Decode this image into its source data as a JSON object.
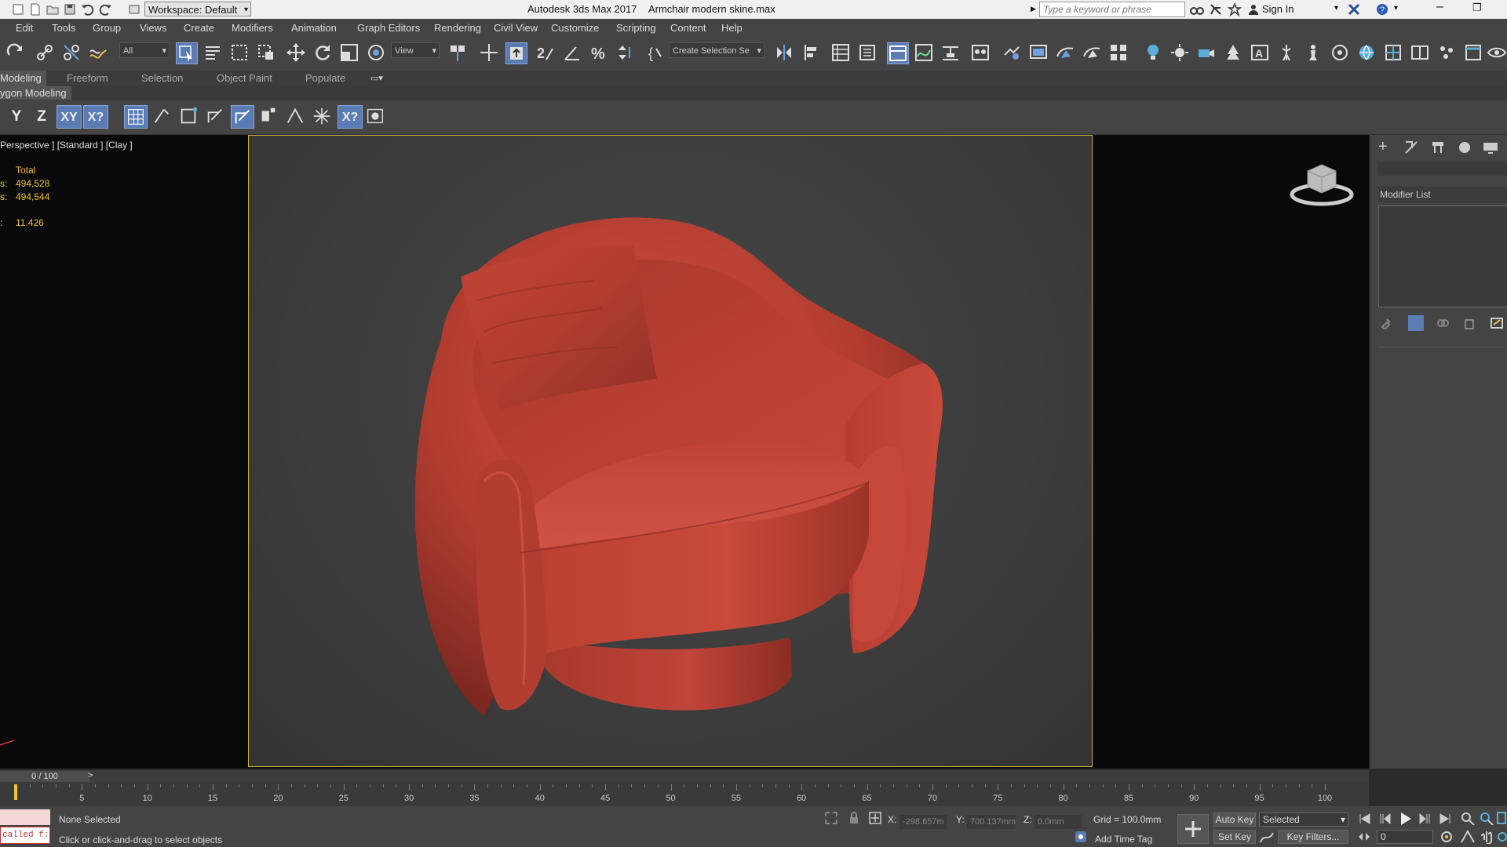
{
  "titlebar": {
    "workspace": "Workspace: Default",
    "app_title": "Autodesk 3ds Max 2017",
    "file_name": "Armchair modern skine.max",
    "search_placeholder": "Type a keyword or phrase",
    "sign_in": "Sign In"
  },
  "menu": [
    "Edit",
    "Tools",
    "Group",
    "Views",
    "Create",
    "Modifiers",
    "Animation",
    "Graph Editors",
    "Rendering",
    "Civil View",
    "Customize",
    "Scripting",
    "Content",
    "Help"
  ],
  "toolbar": {
    "filter_value": "All",
    "view_value": "View",
    "selection_set_value": "Create Selection Se"
  },
  "ribbon": {
    "tabs": [
      "Modeling",
      "Freeform",
      "Selection",
      "Object Paint",
      "Populate"
    ],
    "active_tab": "Modeling",
    "sub_label": "ygon Modeling"
  },
  "snap_toolbar": {
    "y_label": "Y",
    "z_label": "Z",
    "xy_label": "XY",
    "xy2_label": "X?"
  },
  "viewport": {
    "label": "Perspective ] [Standard ] [Clay ]",
    "stats_header": "Total",
    "stat1_prefix": "s:",
    "stat1_value": "494,528",
    "stat2_prefix": "s:",
    "stat2_value": "494,544",
    "stat3_prefix": ":",
    "stat3_value": "11.426"
  },
  "command_panel": {
    "modifier_list": "Modifier List"
  },
  "timeline": {
    "frame_display": "0 / 100",
    "ticks": [
      "5",
      "10",
      "15",
      "20",
      "25",
      "30",
      "35",
      "40",
      "45",
      "50",
      "55",
      "60",
      "65",
      "70",
      "75",
      "80",
      "85",
      "90",
      "95",
      "100"
    ]
  },
  "status": {
    "selection": "None Selected",
    "prompt": "Click or click-and-drag to select objects",
    "script_text": "called f:",
    "x_label": "X:",
    "x_value": "-298.657m",
    "y_label": "Y:",
    "y_value": "700.137mm",
    "z_label": "Z:",
    "z_value": "0.0mm",
    "grid": "Grid = 100.0mm",
    "add_time_tag": "Add Time Tag",
    "auto_key": "Auto Key",
    "set_key": "Set Key",
    "key_mode": "Selected",
    "key_filters": "Key Filters...",
    "frame_value": "0"
  },
  "colors": {
    "chair": "#c0463a",
    "safe_frame": "#c9b53a",
    "stats": "#f0c020",
    "active_button": "#5b7bb5"
  }
}
